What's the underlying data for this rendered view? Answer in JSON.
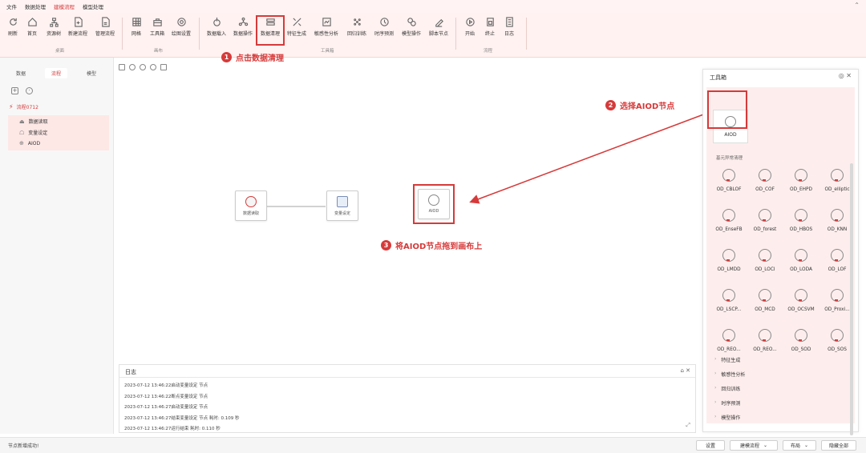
{
  "menubar": {
    "items": [
      "文件",
      "数据处理",
      "建模流程",
      "模型处理"
    ],
    "active_index": 2
  },
  "ribbon": {
    "buttons": [
      {
        "label": "刷新",
        "icon": "refresh-icon"
      },
      {
        "label": "首页",
        "icon": "home-icon"
      },
      {
        "label": "资源树",
        "icon": "tree-icon"
      },
      {
        "label": "新建流程",
        "icon": "new-file-icon"
      },
      {
        "label": "管理流程",
        "icon": "manage-file-icon"
      },
      {
        "label": "网格",
        "icon": "grid-icon"
      },
      {
        "label": "工具箱",
        "icon": "toolbox-icon"
      },
      {
        "label": "绘图设置",
        "icon": "gear-icon"
      },
      {
        "label": "数据载入",
        "icon": "data-load-icon"
      },
      {
        "label": "数据操作",
        "icon": "data-operate-icon"
      },
      {
        "label": "数据清理",
        "icon": "data-clean-icon"
      },
      {
        "label": "特征生成",
        "icon": "feature-icon"
      },
      {
        "label": "敏感性分析",
        "icon": "sensitivity-icon"
      },
      {
        "label": "回归训练",
        "icon": "regression-icon"
      },
      {
        "label": "时序预测",
        "icon": "timeseries-icon"
      },
      {
        "label": "模型操作",
        "icon": "model-icon"
      },
      {
        "label": "脚本节点",
        "icon": "script-icon"
      },
      {
        "label": "开始",
        "icon": "play-icon"
      },
      {
        "label": "终止",
        "icon": "stop-icon"
      },
      {
        "label": "日志",
        "icon": "log-icon"
      }
    ],
    "groups": [
      "桌面",
      "画布",
      "工具箱",
      "流程"
    ]
  },
  "left": {
    "tabs": [
      "数据",
      "流程",
      "模型"
    ],
    "active_tab": 1,
    "tree_root": "流程0712",
    "tree_children": [
      "数据读取",
      "变量设定",
      "AIOD"
    ]
  },
  "canvas": {
    "nodes": [
      "数据读取",
      "变量设定",
      "AIOD"
    ]
  },
  "annotations": [
    {
      "num": "1",
      "text": "点击数据清理"
    },
    {
      "num": "2",
      "text": "选择AIOD节点"
    },
    {
      "num": "3",
      "text": "将AIOD节点拖到画布上"
    }
  ],
  "log": {
    "title": "日志",
    "lines": [
      "2023-07-12 13:46:22启动变量设定 节点",
      "2023-07-12 13:46:22断点变量设定 节点",
      "2023-07-12 13:46:27启动变量设定 节点",
      "2023-07-12 13:46:27结束变量设定 节点 耗时: 0.109 秒",
      "2023-07-12 13:46:27运行结束 耗时: 0.110 秒"
    ]
  },
  "toolbox": {
    "title": "工具箱",
    "selected_tool": "AIOD",
    "category": "基元异常清理",
    "tools": [
      "OD_CBLOF",
      "OD_COF",
      "OD_EHPD",
      "OD_elliptic",
      "OD_EnseFB",
      "OD_forest",
      "OD_HBOS",
      "OD_KNN",
      "OD_LMDD",
      "OD_LOCI",
      "OD_LODA",
      "OD_LOF",
      "OD_LSCP...",
      "OD_MCD",
      "OD_OCSVM",
      "OD_Proxi...",
      "OD_REO...",
      "OD_REO...",
      "OD_SOD",
      "OD_SOS"
    ],
    "accordion": [
      "特征生成",
      "敏感性分析",
      "回归训练",
      "时序预测",
      "模型操作"
    ]
  },
  "status": {
    "text": "节点新增成功!",
    "buttons": [
      "设置",
      "建模流程",
      "布局",
      "隐藏全部"
    ]
  },
  "colors": {
    "accent": "#d63a3a",
    "ribbon_bg": "#fff2f1",
    "highlight": "#fdeeed"
  }
}
